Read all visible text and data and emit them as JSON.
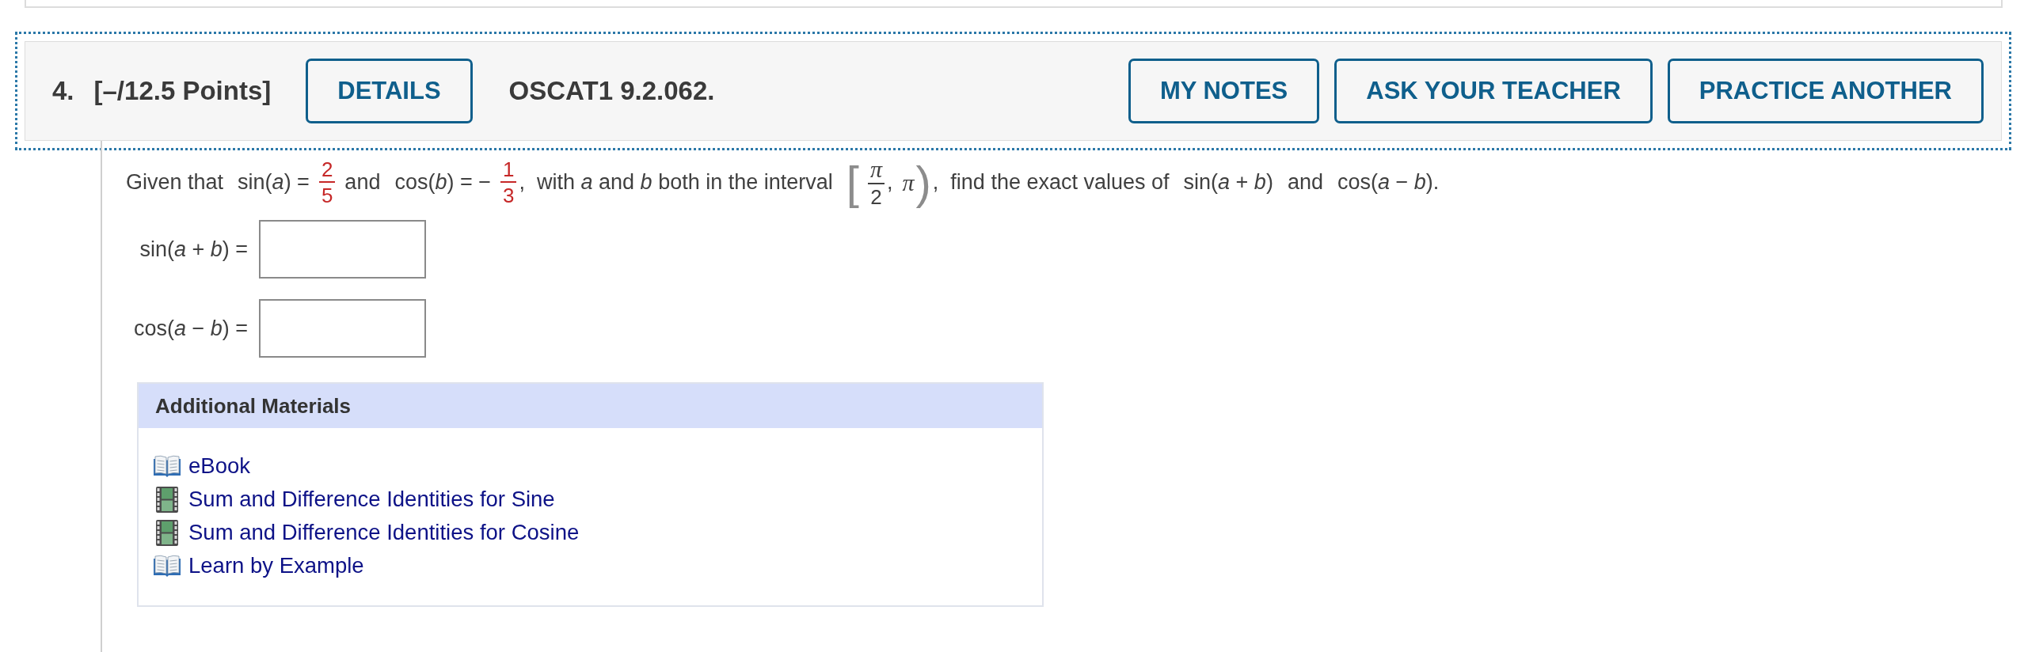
{
  "header": {
    "number": "4.",
    "points": "[–/12.5 Points]",
    "details": "DETAILS",
    "problem_code": "OSCAT1 9.2.062.",
    "buttons": [
      "MY NOTES",
      "ASK YOUR TEACHER",
      "PRACTICE ANOTHER"
    ]
  },
  "prompt": [
    {
      "kind": "text",
      "text": "Given that"
    },
    {
      "kind": "text",
      "text": "sin(*a*) ="
    },
    {
      "kind": "fraction",
      "numerator": "2",
      "denominator": "5",
      "highlighted": true
    },
    {
      "kind": "text",
      "text": "and"
    },
    {
      "kind": "text",
      "text": "cos(*b*) = −"
    },
    {
      "kind": "fraction",
      "numerator": "1",
      "denominator": "3",
      "highlighted": true,
      "suffix": ","
    },
    {
      "kind": "text",
      "text": "with *a* and *b* both in the interval"
    },
    {
      "kind": "interval",
      "open": "[",
      "start": {
        "numerator": "π",
        "denominator": "2",
        "highlighted": false
      },
      "separator": ",",
      "end": "π",
      "close": ")",
      "suffix": ","
    },
    {
      "kind": "text",
      "text": "find the exact values of"
    },
    {
      "kind": "text",
      "text": "sin(*a* + *b*)"
    },
    {
      "kind": "text",
      "text": "and"
    },
    {
      "kind": "text",
      "text": "cos(*a* − *b*)."
    }
  ],
  "answers": [
    {
      "label": "sin(*a* + *b*) ="
    },
    {
      "label": "cos(*a* − *b*) ="
    }
  ],
  "additional_materials": {
    "title": "Additional Materials",
    "links": [
      {
        "kind": "book",
        "label": "eBook"
      },
      {
        "kind": "video",
        "label": "Sum and Difference Identities for Sine"
      },
      {
        "kind": "video",
        "label": "Sum and Difference Identities for Cosine"
      },
      {
        "kind": "book",
        "label": "Learn by Example"
      }
    ]
  }
}
